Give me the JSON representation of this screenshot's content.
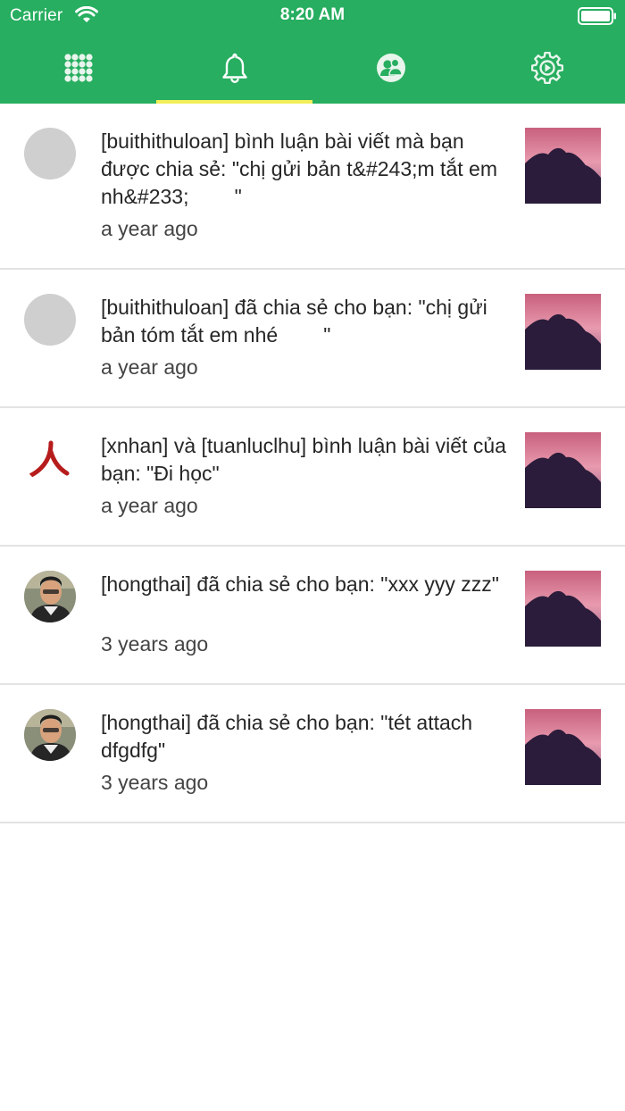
{
  "status_bar": {
    "carrier": "Carrier",
    "time": "8:20 AM",
    "wifi_icon": "wifi-icon",
    "battery_icon": "battery-icon"
  },
  "tabs": [
    {
      "icon": "grid-icon",
      "selected": false
    },
    {
      "icon": "bell-icon",
      "selected": true
    },
    {
      "icon": "friends-icon",
      "selected": false
    },
    {
      "icon": "settings-icon",
      "selected": false
    }
  ],
  "colors": {
    "header": "#27ae60",
    "tab_indicator": "#f2ee5a",
    "divider": "#e3e3e3",
    "text": "#262626"
  },
  "notifications": [
    {
      "avatar": "placeholder-avatar",
      "text": "[buithithuloan] bình luận bài viết mà bạn được chia sẻ: \"chị gửi bản t&#243;m tắt em nh&#233;        \"",
      "time_ago": "a year ago",
      "thumbnail": "sunset-thumbnail"
    },
    {
      "avatar": "placeholder-avatar",
      "text": "[buithithuloan] đã chia sẻ cho bạn: \"chị gửi bản tóm tắt em nhé        \"",
      "time_ago": "a year ago",
      "thumbnail": "sunset-thumbnail"
    },
    {
      "avatar": "kanji-avatar",
      "text": "[xnhan] và [tuanluclhu] bình luận bài viết của bạn: \"Đi học\"",
      "time_ago": "a year ago",
      "thumbnail": "sunset-thumbnail"
    },
    {
      "avatar": "photo-avatar",
      "text": "[hongthai] đã chia sẻ cho bạn: \"xxx yyy zzz\"",
      "time_ago": "3 years ago",
      "thumbnail": "sunset-thumbnail"
    },
    {
      "avatar": "photo-avatar",
      "text": "[hongthai] đã chia sẻ cho bạn: \"tét attach    dfgdfg\"",
      "time_ago": "3 years ago",
      "thumbnail": "sunset-thumbnail"
    }
  ]
}
